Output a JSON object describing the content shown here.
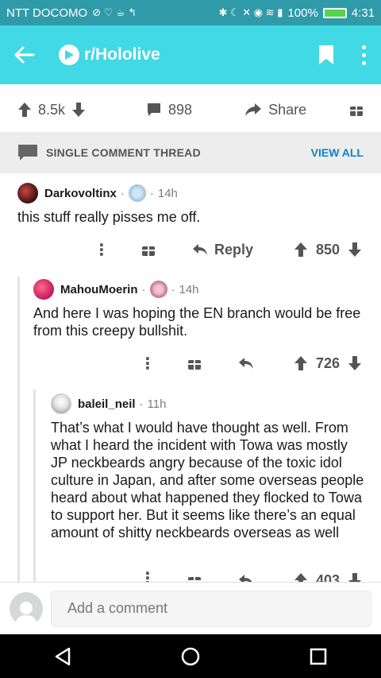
{
  "status": {
    "carrier": "NTT DOCOMO",
    "battery": "100%",
    "time": "4:31"
  },
  "appbar": {
    "subreddit": "r/Hololive"
  },
  "actions": {
    "upvotes": "8.5k",
    "comments": "898",
    "share": "Share"
  },
  "thread": {
    "label": "SINGLE COMMENT THREAD",
    "view_all": "VIEW ALL"
  },
  "comments": [
    {
      "author": "Darkovoltinx",
      "time": "14h",
      "text": "this stuff really pisses me off.",
      "reply": "Reply",
      "score": "850"
    },
    {
      "author": "MahouMoerin",
      "time": "14h",
      "text": "And here I was hoping the EN branch would be free from this creepy bullshit.",
      "score": "726"
    },
    {
      "author": "baleil_neil",
      "time": "11h",
      "text": "That’s what I would have thought as well. From what I heard the incident with Towa was mostly JP neckbeards angry because of the toxic idol culture in Japan, and after some overseas people heard about what happened they flocked to Towa to support her. But it seems like there’s an equal amount of shitty neckbeards overseas as well",
      "score": "403"
    }
  ],
  "composer": {
    "placeholder": "Add a comment"
  },
  "colors": {
    "appbar": "#41d9e3",
    "statusbar": "#2f9aa8",
    "link": "#0a84c6"
  }
}
